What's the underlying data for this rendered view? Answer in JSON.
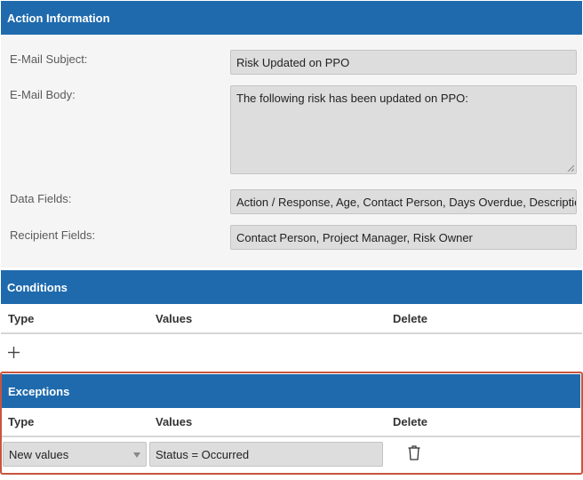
{
  "action_information": {
    "header": "Action Information",
    "email_subject": {
      "label": "E-Mail Subject:",
      "value": "Risk Updated on PPO"
    },
    "email_body": {
      "label": "E-Mail Body:",
      "value": "The following risk has been updated on PPO:"
    },
    "data_fields": {
      "label": "Data Fields:",
      "value": "Action / Response, Age, Contact Person, Days Overdue, Description"
    },
    "recipient_fields": {
      "label": "Recipient Fields:",
      "value": "Contact Person, Project Manager, Risk Owner"
    }
  },
  "conditions": {
    "header": "Conditions",
    "columns": {
      "type": "Type",
      "values": "Values",
      "delete": "Delete"
    },
    "add_icon": "plus-icon"
  },
  "exceptions": {
    "header": "Exceptions",
    "columns": {
      "type": "Type",
      "values": "Values",
      "delete": "Delete"
    },
    "rows": [
      {
        "type": "New values",
        "value": "Status = Occurred",
        "delete_icon": "trash-icon"
      }
    ]
  },
  "colors": {
    "header_bg": "#1f6aad",
    "panel_bg": "#f5f5f5",
    "field_bg": "#dddddd",
    "highlight_border": "#c8553d"
  }
}
